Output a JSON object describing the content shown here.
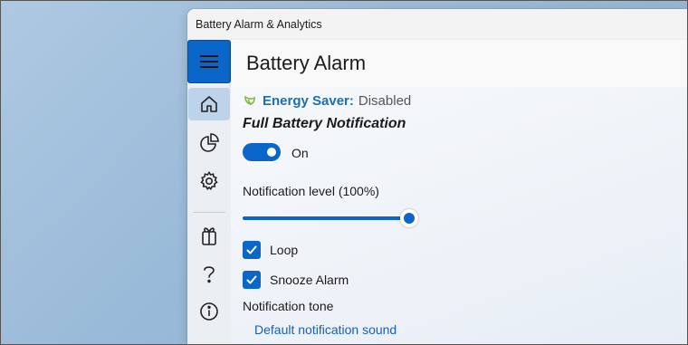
{
  "window": {
    "title": "Battery Alarm & Analytics"
  },
  "header": {
    "title": "Battery Alarm"
  },
  "nav": {
    "items": [
      {
        "icon": "hamburger-menu-icon"
      },
      {
        "icon": "home-icon",
        "selected": true
      },
      {
        "icon": "pie-chart-icon"
      },
      {
        "icon": "gear-icon"
      },
      {
        "icon": "gift-icon"
      },
      {
        "icon": "question-mark-icon"
      },
      {
        "icon": "info-icon"
      }
    ]
  },
  "energy_saver": {
    "label": "Energy Saver:",
    "value": "Disabled"
  },
  "full_battery": {
    "section_title": "Full Battery Notification",
    "toggle_label": "On",
    "toggle_on": true,
    "level_label": "Notification level (100%)",
    "level_value": 100,
    "loop_label": "Loop",
    "loop_checked": true,
    "snooze_label": "Snooze Alarm",
    "snooze_checked": true,
    "tone_label": "Notification tone",
    "tone_value": "Default notification sound"
  },
  "colors": {
    "accent": "#0a66c8",
    "link": "#1a5fb0",
    "energy_saver_label": "#1a6fb5",
    "leaf": "#7fb842"
  }
}
